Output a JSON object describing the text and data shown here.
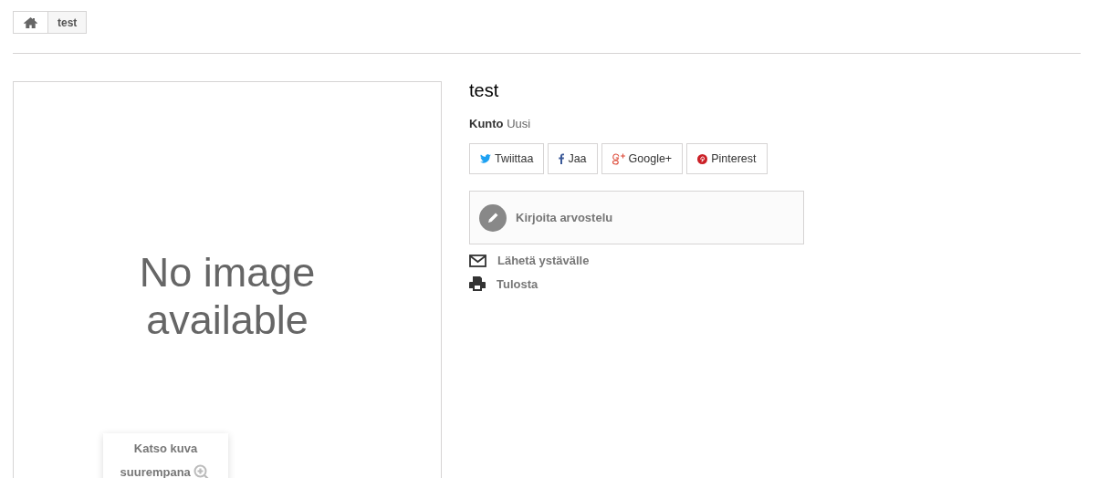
{
  "breadcrumb": {
    "items": [
      {
        "label": "test"
      }
    ]
  },
  "image": {
    "placeholder_text": "No image available",
    "zoom_label": "Katso kuva suurempana"
  },
  "product": {
    "title": "test",
    "condition_label": "Kunto",
    "condition_value": "Uusi"
  },
  "share_buttons": [
    {
      "kind": "twitter",
      "label": "Twiittaa"
    },
    {
      "kind": "facebook",
      "label": "Jaa"
    },
    {
      "kind": "google",
      "label": "Google+"
    },
    {
      "kind": "pinterest",
      "label": "Pinterest"
    }
  ],
  "review": {
    "label": "Kirjoita arvostelu"
  },
  "actions": [
    {
      "kind": "email",
      "label": "Lähetä ystävälle"
    },
    {
      "kind": "print",
      "label": "Tulosta"
    }
  ]
}
